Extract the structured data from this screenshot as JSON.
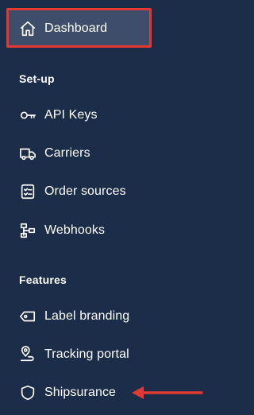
{
  "sidebar": {
    "active_item": {
      "label": "Dashboard",
      "icon": "home-icon"
    },
    "sections": [
      {
        "heading": "Set-up",
        "items": [
          {
            "label": "API Keys",
            "icon": "key-icon"
          },
          {
            "label": "Carriers",
            "icon": "truck-icon"
          },
          {
            "label": "Order sources",
            "icon": "checklist-icon"
          },
          {
            "label": "Webhooks",
            "icon": "webhook-icon"
          }
        ]
      },
      {
        "heading": "Features",
        "items": [
          {
            "label": "Label branding",
            "icon": "tag-icon"
          },
          {
            "label": "Tracking portal",
            "icon": "map-pin-icon"
          },
          {
            "label": "Shipsurance",
            "icon": "shield-icon"
          }
        ]
      }
    ]
  },
  "colors": {
    "sidebar_background": "#1c2d49",
    "active_background": "#3e4e6a",
    "annotation_red": "#e23a33",
    "text": "#ffffff"
  }
}
